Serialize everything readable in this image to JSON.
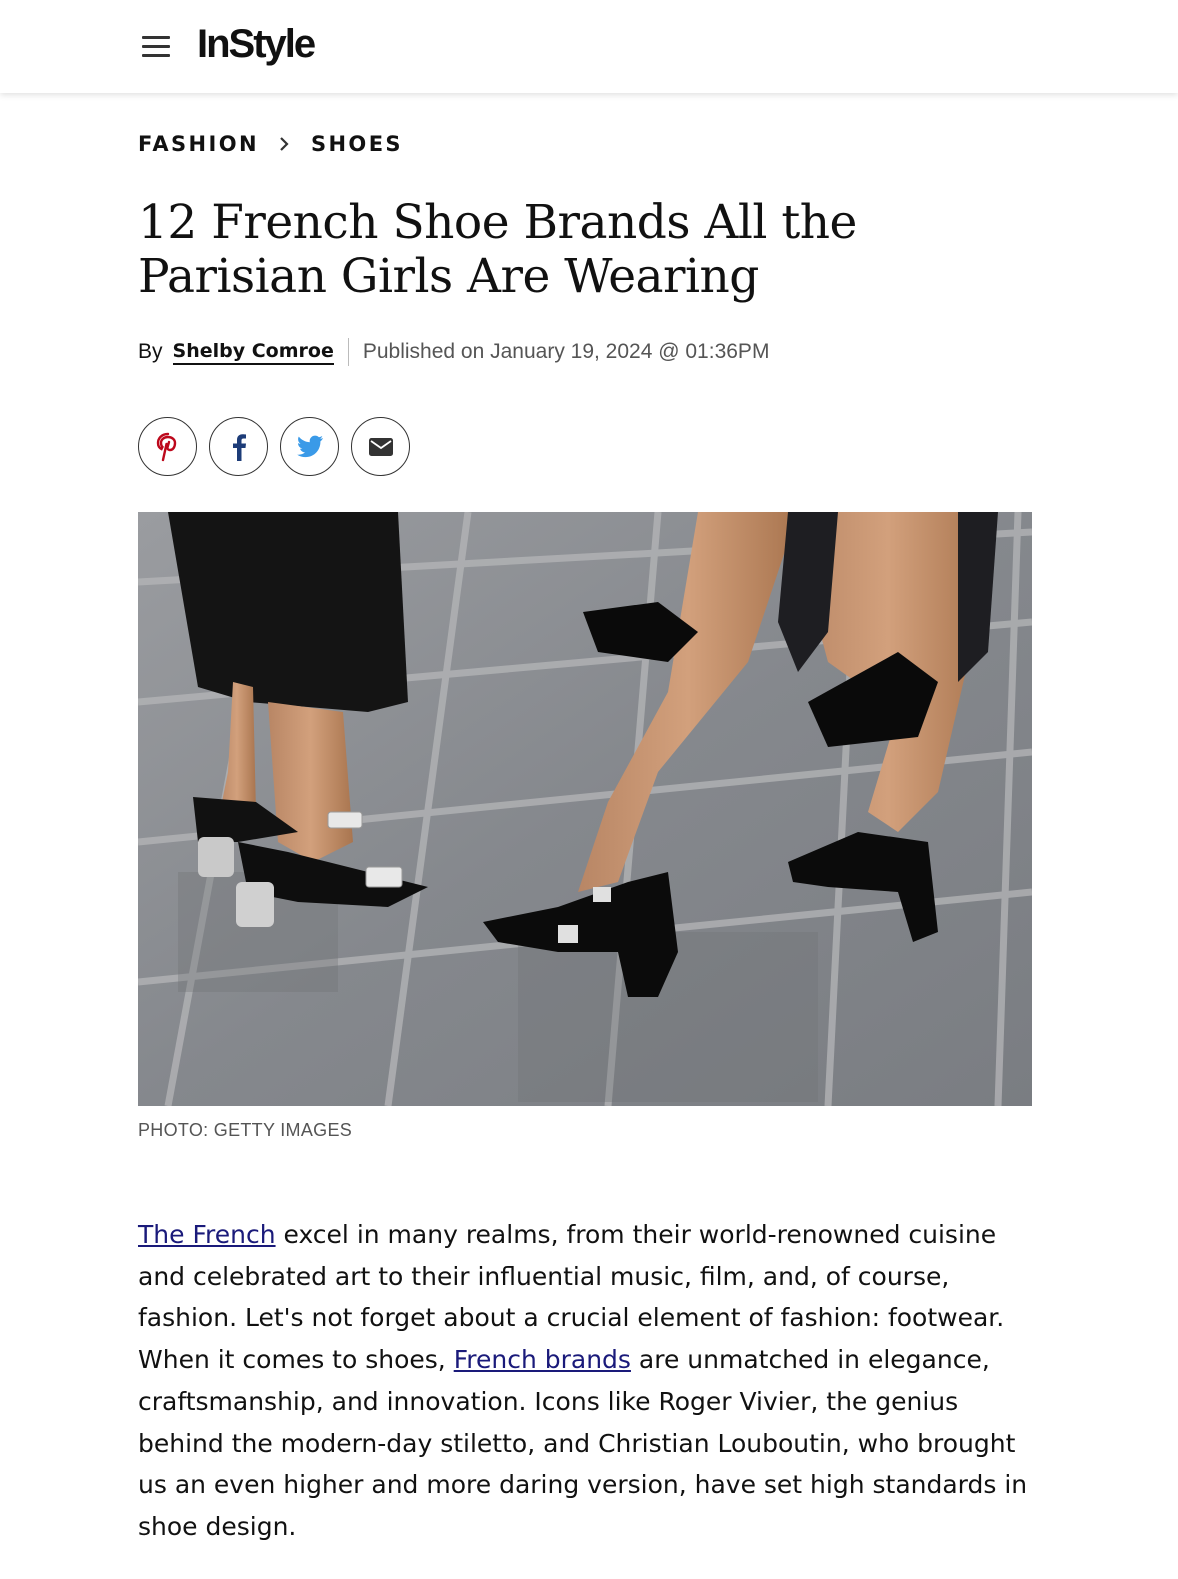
{
  "header": {
    "logo": "InStyle"
  },
  "breadcrumb": {
    "items": [
      "FASHION",
      "SHOES"
    ]
  },
  "article": {
    "title": "12 French Shoe Brands All the Parisian Girls Are Wearing",
    "by_label": "By",
    "author": "Shelby Comroe",
    "published": "Published on January 19, 2024 @ 01:36PM",
    "share": [
      "pinterest-icon",
      "facebook-icon",
      "twitter-icon",
      "email-icon"
    ],
    "photo_credit": "PHOTO: GETTY IMAGES",
    "paragraph": {
      "link1": "The French",
      "text1": " excel in many realms, from their world-renowned cuisine and celebrated art to their influential music, film, and, of course, fashion. Let's not forget about a crucial element of fashion: footwear. When it comes to shoes, ",
      "link2": "French brands",
      "text2": " are unmatched in elegance, craftsmanship, and innovation. Icons like Roger Vivier, the genius behind the modern-day stiletto, and Christian Louboutin, who brought us an even higher and more daring version, have set high standards in shoe design."
    }
  },
  "colors": {
    "pinterest": "#bd081c",
    "facebook": "#1d3c78",
    "twitter": "#3a9ae8",
    "link": "#1a1a7a"
  }
}
